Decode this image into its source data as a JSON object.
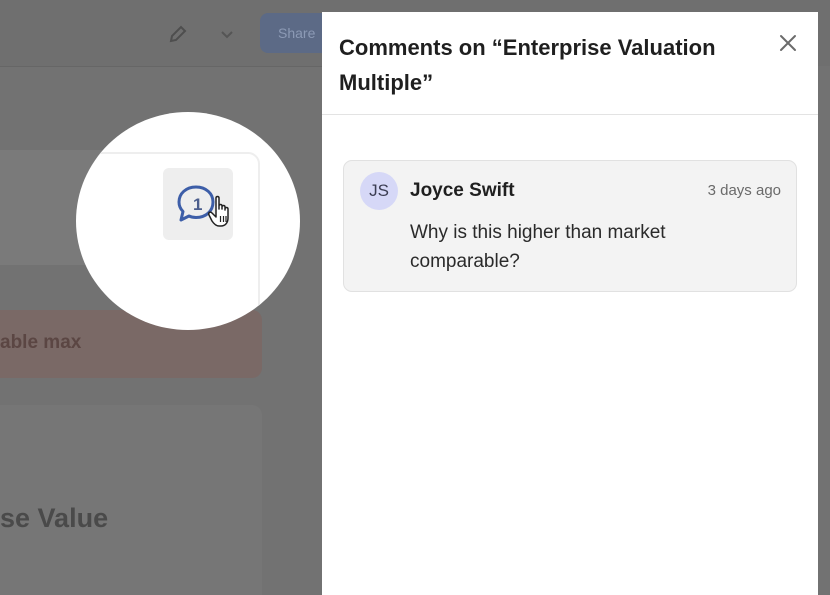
{
  "background": {
    "share_label": "Share",
    "alert_text": "able max",
    "card_title": "se Value"
  },
  "magnifier": {
    "comment_count": "1"
  },
  "panel": {
    "title": "Comments on “Enterprise Valuation Multiple”",
    "comments": [
      {
        "initials": "JS",
        "author": "Joyce Swift",
        "timestamp": "3 days ago",
        "body": "Why is this higher than market comparable?"
      }
    ]
  },
  "colors": {
    "overlay": "#727272",
    "avatar_bg": "#d6d8f7",
    "bubble_icon": "#3d5ea8"
  }
}
